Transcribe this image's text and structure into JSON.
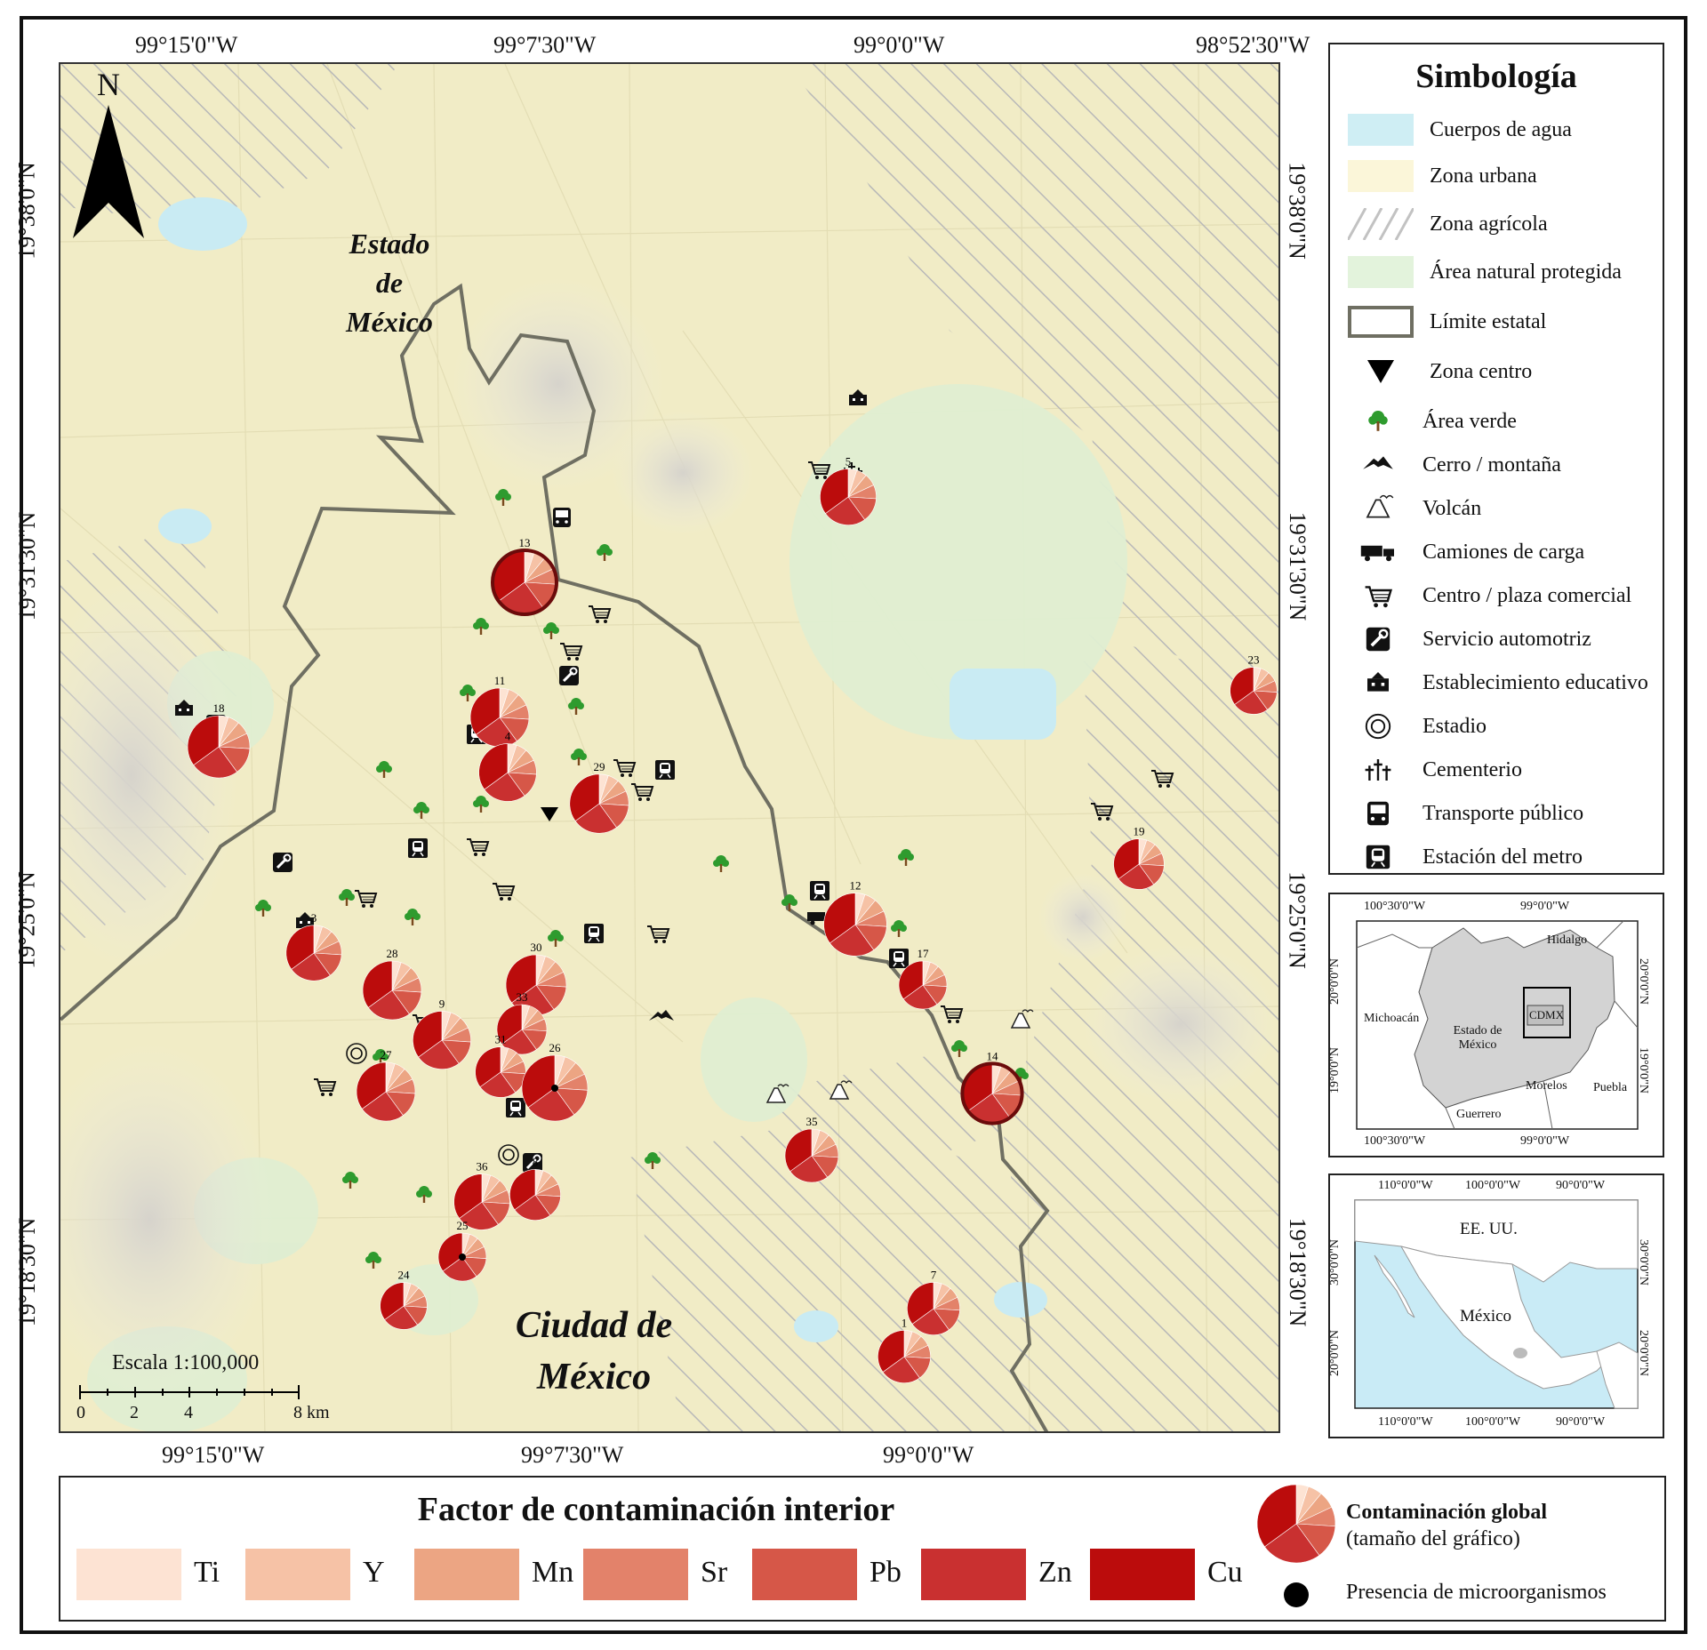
{
  "axes": {
    "top": [
      "99°15'0\"W",
      "99°7'30\"W",
      "99°0'0\"W",
      "98°52'30\"W"
    ],
    "bottom": [
      "99°15'0\"W",
      "99°7'30\"W",
      "99°0'0\"W"
    ],
    "left": [
      "19°38'0\"N",
      "19°31'30\"N",
      "19°25'0\"N",
      "19°18'30\"N"
    ],
    "right": [
      "19°38'0\"N",
      "19°31'30\"N",
      "19°25'0\"N",
      "19°18'30\"N"
    ]
  },
  "north_arrow": "N",
  "map_labels": {
    "estado_line1": "Estado",
    "estado_line2": "de",
    "estado_line3": "México",
    "cdmx_line1": "Ciudad de",
    "cdmx_line2": "México"
  },
  "scale": {
    "title": "Escala 1:100,000",
    "ticks": [
      "0",
      "2",
      "4",
      "8 km"
    ]
  },
  "legend": {
    "title": "Simbología",
    "areas": [
      {
        "label": "Cuerpos de agua",
        "color": "#cfeef4"
      },
      {
        "label": "Zona urbana",
        "color": "#fbf6d9"
      },
      {
        "label": "Zona agrícola",
        "color": "hatch"
      },
      {
        "label": "Área natural protegida",
        "color": "#e3f3dc"
      },
      {
        "label": "Límite estatal",
        "color": "#6f6f62"
      },
      {
        "label": "Zona centro",
        "color": "#000000"
      }
    ],
    "icons": [
      {
        "label": "Área verde",
        "icon": "tree-icon"
      },
      {
        "label": "Cerro / montaña",
        "icon": "mountain-icon"
      },
      {
        "label": "Volcán",
        "icon": "volcano-icon"
      },
      {
        "label": "Camiones de carga",
        "icon": "truck-icon"
      },
      {
        "label": "Centro / plaza comercial",
        "icon": "cart-icon"
      },
      {
        "label": "Servicio automotriz",
        "icon": "wrench-icon"
      },
      {
        "label": "Establecimiento educativo",
        "icon": "school-icon"
      },
      {
        "label": "Estadio",
        "icon": "stadium-icon"
      },
      {
        "label": "Cementerio",
        "icon": "cemetery-icon"
      },
      {
        "label": "Transporte público",
        "icon": "bus-icon"
      },
      {
        "label": "Estación del metro",
        "icon": "metro-icon"
      }
    ]
  },
  "inset_mexico_state": {
    "top": [
      "100°30'0\"W",
      "99°0'0\"W"
    ],
    "bottom": [
      "100°30'0\"W",
      "99°0'0\"W"
    ],
    "left": [
      "20°0'0\"N",
      "19°0'0\"N"
    ],
    "right": [
      "20°0'0\"N",
      "19°0'0\"N"
    ],
    "regions": [
      "Hidalgo",
      "Michoacán",
      "Estado de México",
      "CDMX",
      "Morelos",
      "Puebla",
      "Guerrero"
    ]
  },
  "inset_country": {
    "top": [
      "110°0'0\"W",
      "100°0'0\"W",
      "90°0'0\"W"
    ],
    "bottom": [
      "110°0'0\"W",
      "100°0'0\"W",
      "90°0'0\"W"
    ],
    "left": [
      "30°0'0\"N",
      "20°0'0\"N"
    ],
    "right": [
      "30°0'0\"N",
      "20°0'0\"N"
    ],
    "regions": [
      "EE. UU.",
      "México"
    ]
  },
  "bottom_legend": {
    "title": "Factor de contaminación interior",
    "elements": [
      {
        "label": "Ti",
        "color": "#fde3d3"
      },
      {
        "label": "Y",
        "color": "#f6c2a6"
      },
      {
        "label": "Mn",
        "color": "#eca583"
      },
      {
        "label": "Sr",
        "color": "#e3826a"
      },
      {
        "label": "Pb",
        "color": "#d65748"
      },
      {
        "label": "Zn",
        "color": "#c93030"
      },
      {
        "label": "Cu",
        "color": "#bb0c0c"
      }
    ],
    "global_line1": "Contaminación global",
    "global_line2": "(tamaño del gráfico)",
    "micro": "Presencia de microorganismos"
  },
  "sites": [
    {
      "id": "13",
      "size": 1.0,
      "micro": false,
      "highlight": true
    },
    {
      "id": "5",
      "size": 0.78,
      "micro": false,
      "highlight": false
    },
    {
      "id": "23",
      "size": 0.52,
      "micro": false,
      "highlight": false
    },
    {
      "id": "18",
      "size": 0.95,
      "micro": false,
      "highlight": false
    },
    {
      "id": "11",
      "size": 0.85,
      "micro": false,
      "highlight": false
    },
    {
      "id": "4",
      "size": 0.82,
      "micro": false,
      "highlight": false
    },
    {
      "id": "29",
      "size": 0.86,
      "micro": false,
      "highlight": false
    },
    {
      "id": "19",
      "size": 0.62,
      "micro": false,
      "highlight": false
    },
    {
      "id": "12",
      "size": 0.97,
      "micro": false,
      "highlight": false
    },
    {
      "id": "3",
      "size": 0.76,
      "micro": false,
      "highlight": false
    },
    {
      "id": "28",
      "size": 0.85,
      "micro": false,
      "highlight": false
    },
    {
      "id": "30",
      "size": 0.9,
      "micro": false,
      "highlight": false
    },
    {
      "id": "17",
      "size": 0.55,
      "micro": false,
      "highlight": false
    },
    {
      "id": "9",
      "size": 0.83,
      "micro": false,
      "highlight": false
    },
    {
      "id": "33",
      "size": 0.6,
      "micro": false,
      "highlight": false
    },
    {
      "id": "14",
      "size": 0.88,
      "micro": false,
      "highlight": true
    },
    {
      "id": "27",
      "size": 0.85,
      "micro": false,
      "highlight": false
    },
    {
      "id": "31",
      "size": 0.62,
      "micro": false,
      "highlight": false
    },
    {
      "id": "26",
      "size": 1.05,
      "micro": true,
      "highlight": false
    },
    {
      "id": "35",
      "size": 0.7,
      "micro": false,
      "highlight": false
    },
    {
      "id": "36",
      "size": 0.77,
      "micro": false,
      "highlight": false
    },
    {
      "id": "8",
      "size": 0.63,
      "micro": false,
      "highlight": false
    },
    {
      "id": "25",
      "size": 0.55,
      "micro": true,
      "highlight": false
    },
    {
      "id": "7",
      "size": 0.68,
      "micro": false,
      "highlight": false
    },
    {
      "id": "24",
      "size": 0.52,
      "micro": false,
      "highlight": false
    },
    {
      "id": "1",
      "size": 0.68,
      "micro": false,
      "highlight": false
    }
  ]
}
